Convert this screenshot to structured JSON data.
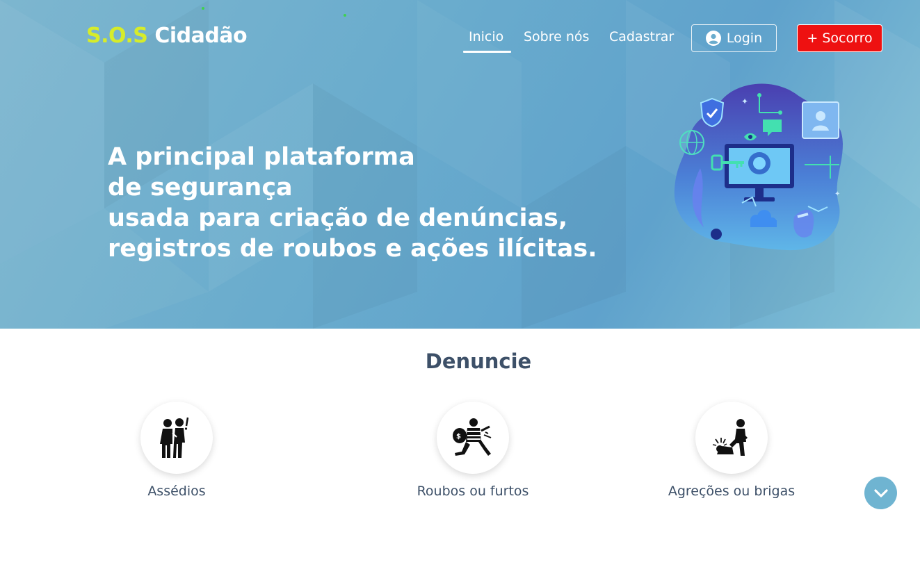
{
  "brand": {
    "accent": "S.O.S",
    "name": "Cidadão"
  },
  "nav": {
    "items": [
      {
        "label": "Inicio",
        "active": true
      },
      {
        "label": "Sobre nós",
        "active": false
      },
      {
        "label": "Cadastrar",
        "active": false
      }
    ],
    "login_label": "Login",
    "sos_label": "+ Socorro"
  },
  "hero": {
    "lines": [
      "A principal plataforma",
      "de segurança",
      "usada para criação de denúncias,",
      "registros de roubos e ações ilícitas."
    ]
  },
  "denuncie": {
    "title": "Denuncie",
    "categories": [
      {
        "label": "Assédios",
        "icon": "harassment-icon"
      },
      {
        "label": "Roubos ou furtos",
        "icon": "robbery-icon"
      },
      {
        "label": "Agreções ou brigas",
        "icon": "fight-icon"
      }
    ]
  },
  "colors": {
    "brand_accent": "#d6ec2a",
    "sos_red": "#ee1111",
    "heading": "#3d5068",
    "hero_blue": "#6aaccd"
  }
}
